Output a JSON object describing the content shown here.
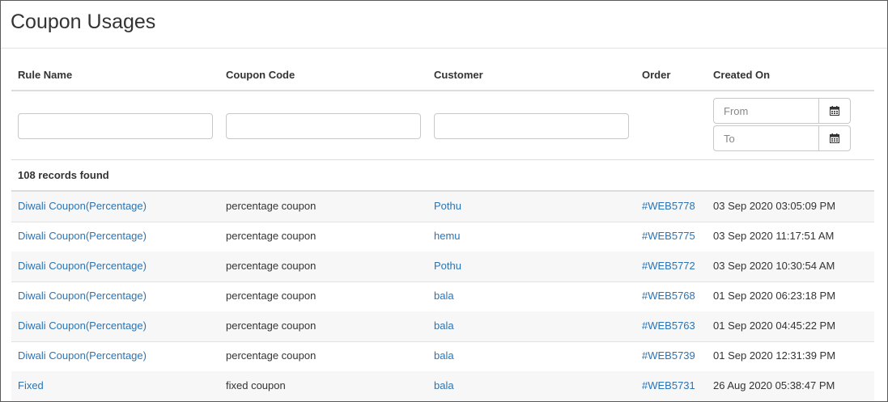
{
  "page": {
    "title": "Coupon Usages"
  },
  "columns": {
    "rule_name": "Rule Name",
    "coupon_code": "Coupon Code",
    "customer": "Customer",
    "order": "Order",
    "created_on": "Created On"
  },
  "filters": {
    "from_placeholder": "From",
    "to_placeholder": "To"
  },
  "records_found": "108 records found",
  "rows": [
    {
      "rule_name": "Diwali Coupon(Percentage)",
      "coupon_code": "percentage coupon",
      "customer": "Pothu",
      "order": "#WEB5778",
      "created_on": "03 Sep 2020 03:05:09 PM"
    },
    {
      "rule_name": "Diwali Coupon(Percentage)",
      "coupon_code": "percentage coupon",
      "customer": "hemu",
      "order": "#WEB5775",
      "created_on": "03 Sep 2020 11:17:51 AM"
    },
    {
      "rule_name": "Diwali Coupon(Percentage)",
      "coupon_code": "percentage coupon",
      "customer": "Pothu",
      "order": "#WEB5772",
      "created_on": "03 Sep 2020 10:30:54 AM"
    },
    {
      "rule_name": "Diwali Coupon(Percentage)",
      "coupon_code": "percentage coupon",
      "customer": "bala",
      "order": "#WEB5768",
      "created_on": "01 Sep 2020 06:23:18 PM"
    },
    {
      "rule_name": "Diwali Coupon(Percentage)",
      "coupon_code": "percentage coupon",
      "customer": "bala",
      "order": "#WEB5763",
      "created_on": "01 Sep 2020 04:45:22 PM"
    },
    {
      "rule_name": "Diwali Coupon(Percentage)",
      "coupon_code": "percentage coupon",
      "customer": "bala",
      "order": "#WEB5739",
      "created_on": "01 Sep 2020 12:31:39 PM"
    },
    {
      "rule_name": "Fixed",
      "coupon_code": "fixed coupon",
      "customer": "bala",
      "order": "#WEB5731",
      "created_on": "26 Aug 2020 05:38:47 PM"
    }
  ],
  "colors": {
    "link": "#2a74b5",
    "row_stripe": "#f7f7f7",
    "border": "#dcdcdc"
  },
  "icons": {
    "date_picker": "calendar-icon"
  }
}
